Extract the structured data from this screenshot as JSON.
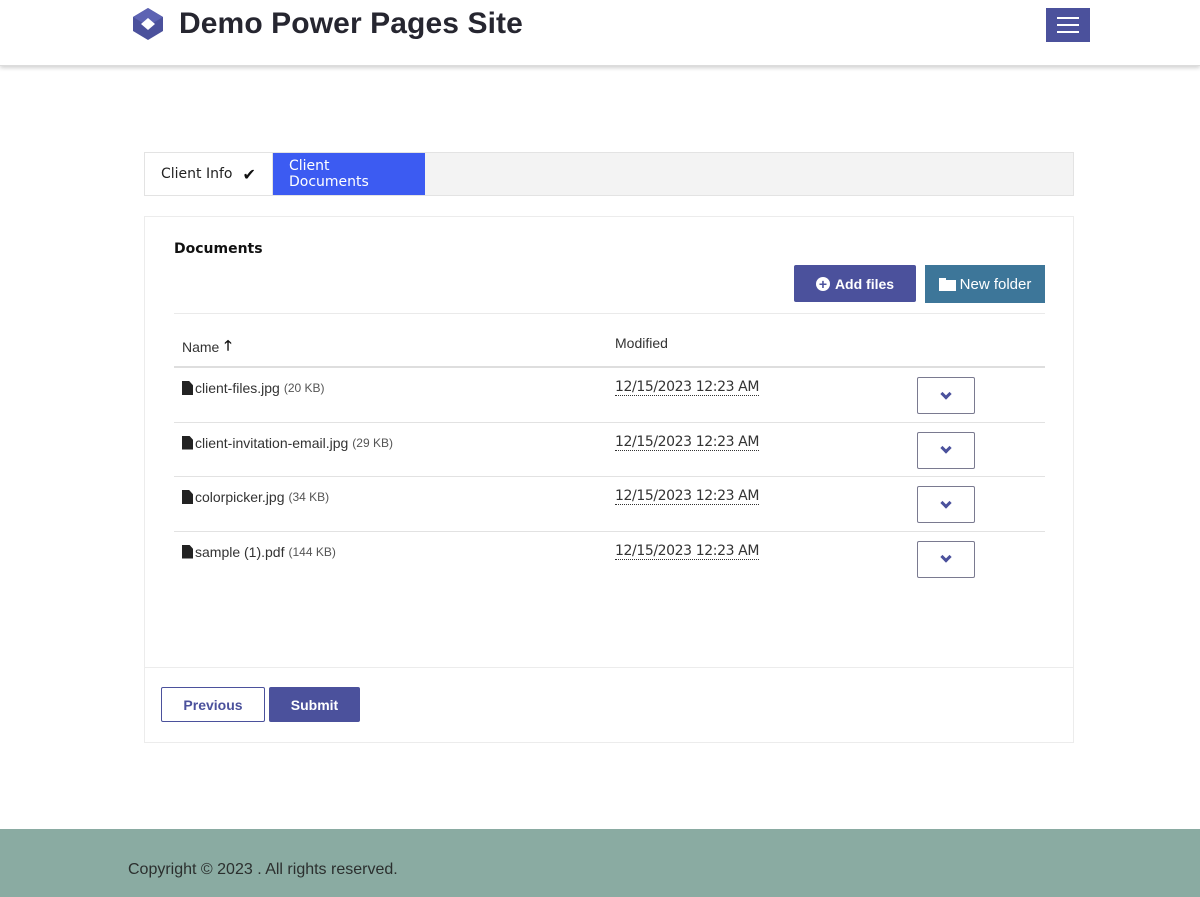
{
  "header": {
    "site_title": "Demo Power Pages Site",
    "logo_icon": "diamond-logo-icon",
    "menu_icon": "hamburger-menu-icon",
    "brand_color": "#4b519c"
  },
  "steps": [
    {
      "label": "Client Info",
      "status": "completed",
      "icon": "checkmark-icon"
    },
    {
      "label": "Client Documents",
      "status": "active"
    }
  ],
  "documents": {
    "title": "Documents",
    "add_files_label": "Add files",
    "new_folder_label": "New folder",
    "columns": {
      "name": "Name",
      "modified": "Modified",
      "sort": "ascending"
    },
    "files": [
      {
        "name": "client-files.jpg",
        "size": "(20 KB)",
        "modified": "12/15/2023 12:23 AM"
      },
      {
        "name": "client-invitation-email.jpg",
        "size": "(29 KB)",
        "modified": "12/15/2023 12:23 AM"
      },
      {
        "name": "colorpicker.jpg",
        "size": "(34 KB)",
        "modified": "12/15/2023 12:23 AM"
      },
      {
        "name": "sample (1).pdf",
        "size": "(144 KB)",
        "modified": "12/15/2023 12:23 AM"
      }
    ]
  },
  "actions": {
    "previous_label": "Previous",
    "submit_label": "Submit"
  },
  "footer": {
    "copyright": "Copyright © 2023 . All rights reserved."
  },
  "colors": {
    "primary": "#4b519c",
    "active_tab": "#3c5bf2",
    "folder_button": "#3d7699",
    "footer_bg": "#8aaba2"
  }
}
